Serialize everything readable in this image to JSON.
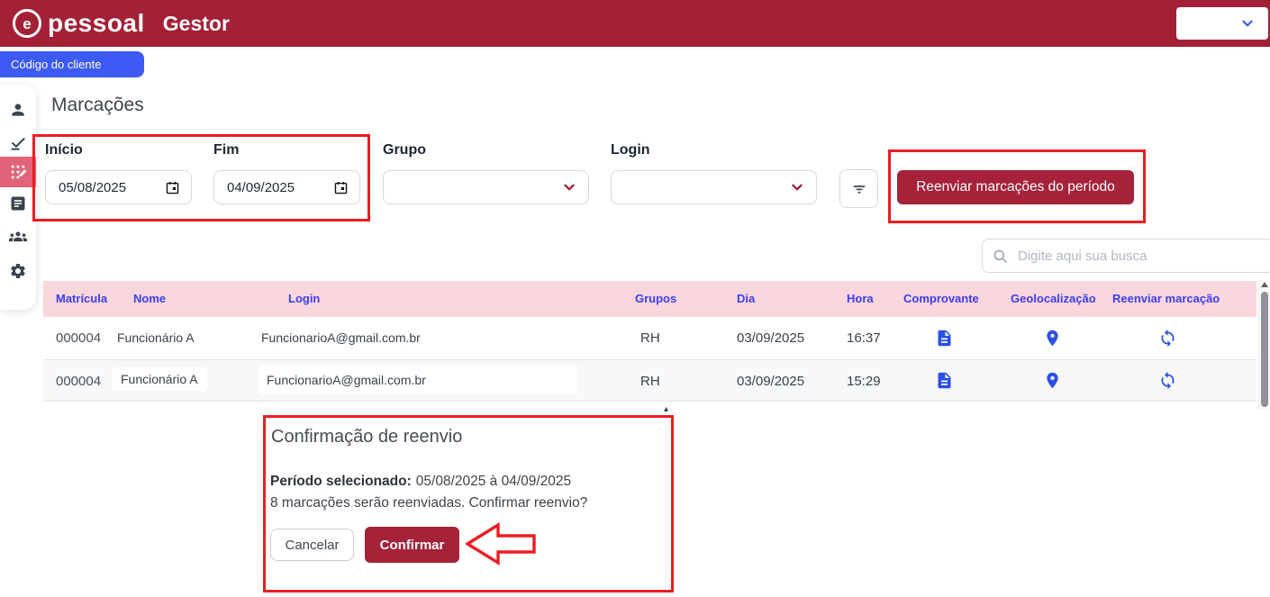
{
  "brand": {
    "e": "e",
    "name": "pessoal",
    "product": "Gestor"
  },
  "client_button": {
    "label": "Código do cliente"
  },
  "page": {
    "title": "Marcações"
  },
  "filters": {
    "inicio_label": "Início",
    "inicio_value": "05/08/2025",
    "fim_label": "Fim",
    "fim_value": "04/09/2025",
    "grupo_label": "Grupo",
    "grupo_value": "",
    "login_label": "Login",
    "login_value": "",
    "resend_label": "Reenviar marcações do período"
  },
  "search": {
    "placeholder": "Digite aqui sua busca"
  },
  "table": {
    "columns": [
      "Matrícula",
      "Nome",
      "Login",
      "Grupos",
      "Dia",
      "Hora",
      "Comprovante",
      "Geolocalização",
      "Reenviar marcação"
    ],
    "rows": [
      {
        "matricula": "000004",
        "nome": "Funcionário A",
        "login": "FuncionarioA@gmail.com.br",
        "grupos": "RH",
        "dia": "03/09/2025",
        "hora": "16:37"
      },
      {
        "matricula": "000004",
        "nome": "Funcionário A",
        "login": "FuncionarioA@gmail.com.br",
        "grupos": "RH",
        "dia": "03/09/2025",
        "hora": "15:29"
      }
    ]
  },
  "modal": {
    "title": "Confirmação de reenvio",
    "period_label": "Período selecionado:",
    "period_value": "05/08/2025 à 04/09/2025",
    "message": "8 marcações serão reenviadas. Confirmar reenvio?",
    "cancel_label": "Cancelar",
    "confirm_label": "Confirmar"
  },
  "colors": {
    "header_bg": "#A32036",
    "accent_red": "#A52239",
    "active_pink": "#E2647B",
    "annotation_red": "#EC1C24",
    "table_header_bg": "#F7D6DC",
    "table_header_text": "#3E3EF2",
    "icon_blue": "#2B4FE4",
    "client_button_blue": "#3D5AF5"
  }
}
